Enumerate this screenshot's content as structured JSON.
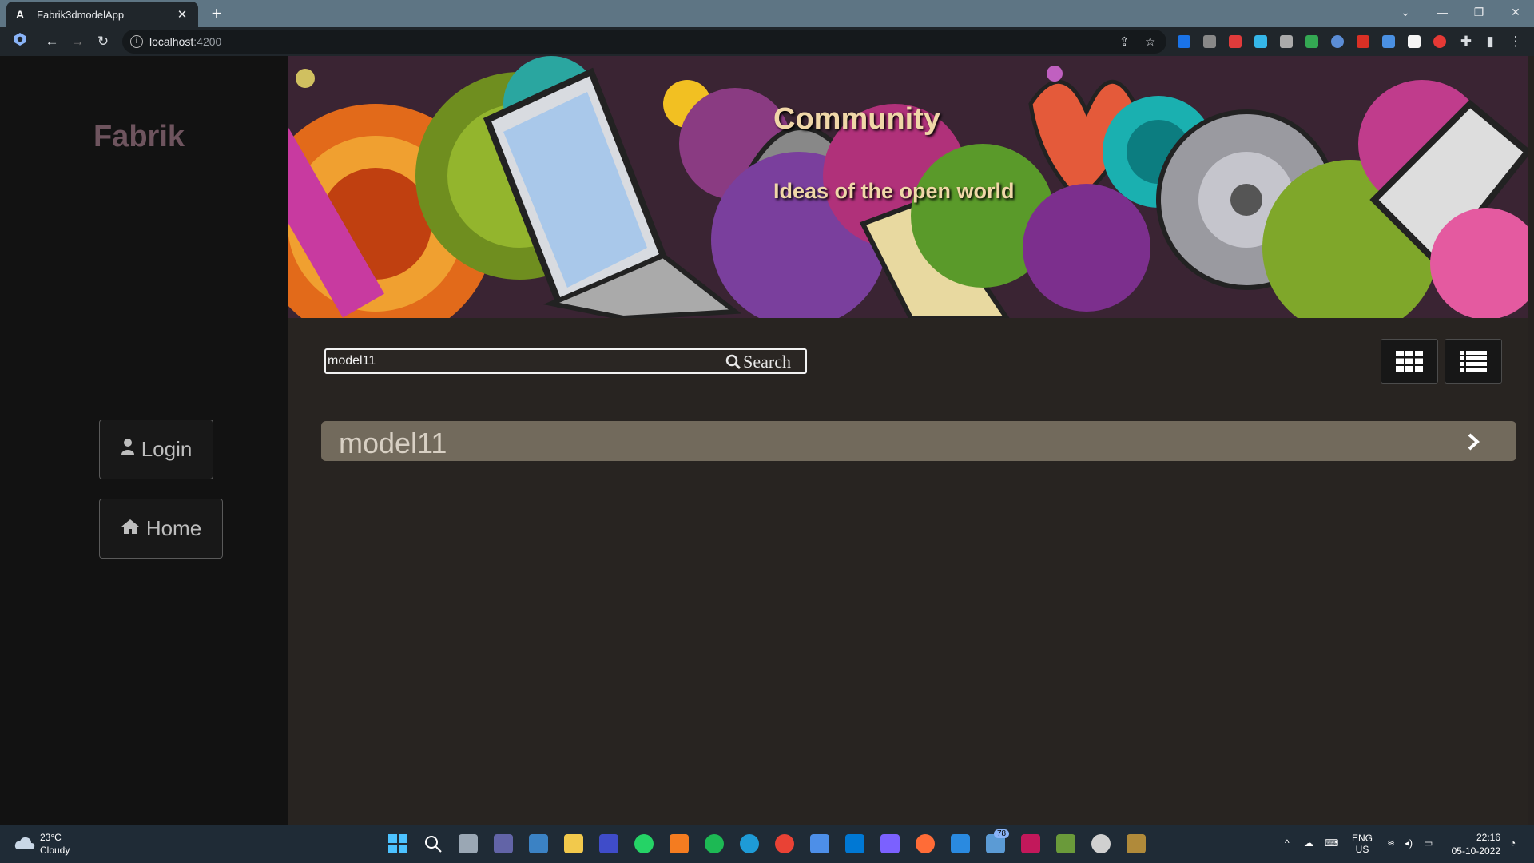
{
  "browser": {
    "tab_title": "Fabrik3dmodelApp",
    "tab_favicon": "A",
    "new_tab_icon": "plus-icon",
    "url_host": "localhost",
    "url_port": ":4200"
  },
  "sidebar": {
    "brand": "Fabrik",
    "login_label": "Login",
    "home_label": "Home"
  },
  "banner": {
    "title": "Community",
    "subtitle": "Ideas of the open world"
  },
  "search": {
    "value": "model11",
    "button_label": "Search"
  },
  "results": [
    {
      "label": "model11"
    }
  ],
  "taskbar": {
    "temp": "23°C",
    "weather": "Cloudy",
    "lang_top": "ENG",
    "lang_bottom": "US",
    "time": "22:16",
    "date": "05-10-2022",
    "badge": "78"
  },
  "colors": {
    "brand": "#6e545e",
    "result_bg": "#726a5c",
    "banner_text": "#f0d7a8"
  }
}
